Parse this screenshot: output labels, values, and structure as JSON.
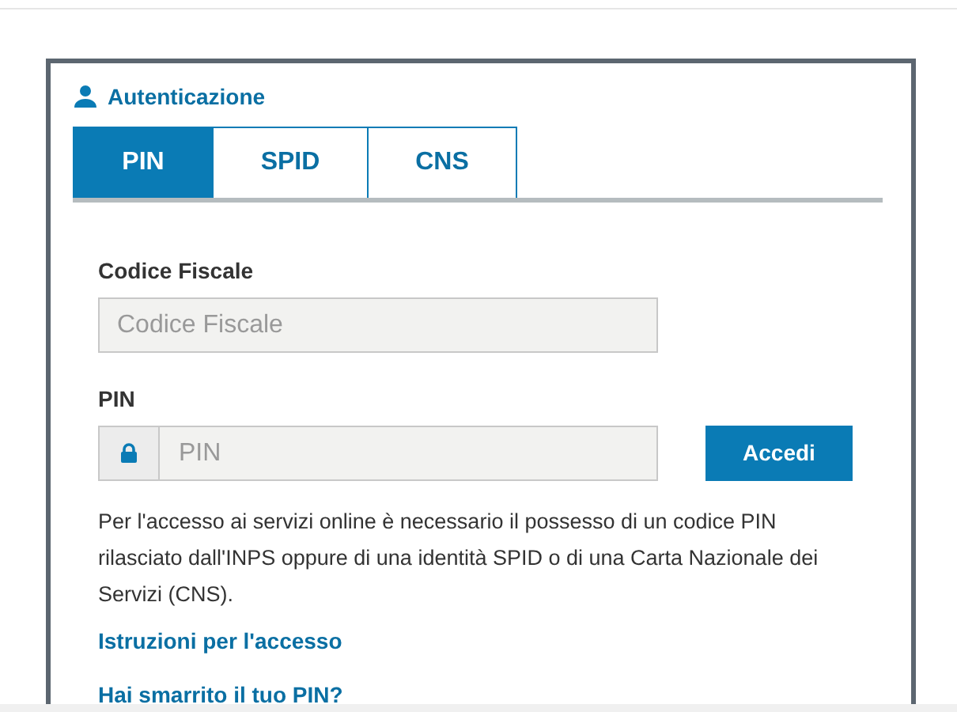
{
  "header": {
    "title": "Autenticazione"
  },
  "tabs": [
    {
      "label": "PIN",
      "selected": true
    },
    {
      "label": "SPID",
      "selected": false
    },
    {
      "label": "CNS",
      "selected": false
    }
  ],
  "fields": [
    {
      "label": "Codice Fiscale",
      "placeholder": "Codice Fiscale",
      "kind": "plain"
    },
    {
      "label": "PIN",
      "placeholder": "PIN",
      "kind": "locked"
    }
  ],
  "submit": "Accedi",
  "info": "Per l'accesso ai servizi online è necessario il possesso di un codice PIN rilasciato dall'INPS oppure di una identità SPID o di una Carta Nazionale dei Servizi (CNS).",
  "links": [
    "Istruzioni per l'accesso",
    "Hai smarrito il tuo PIN?"
  ]
}
